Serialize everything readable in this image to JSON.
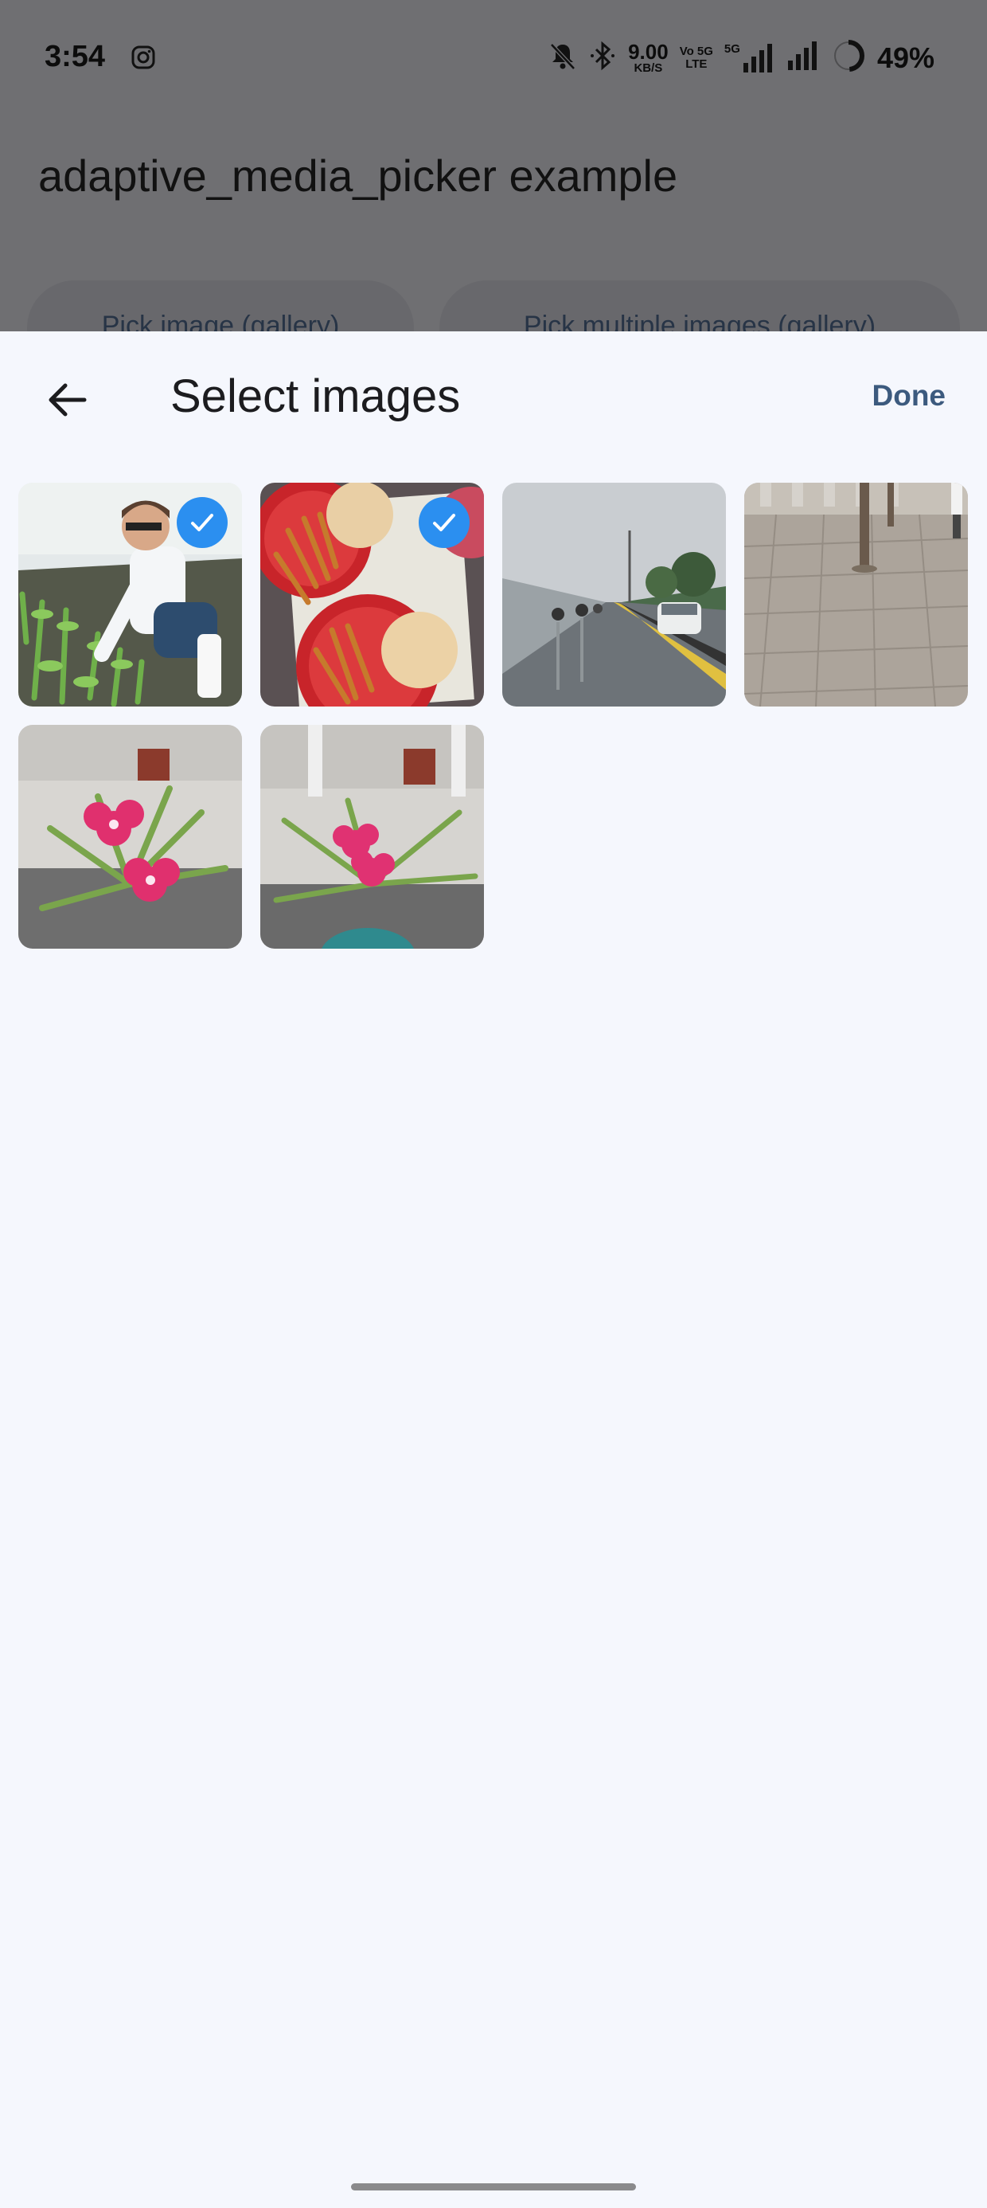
{
  "status_bar": {
    "time": "3:54",
    "net_speed_value": "9.00",
    "net_speed_unit": "KB/S",
    "volte_line1": "Vo 5G",
    "volte_line2": "LTE",
    "network_type": "5G",
    "battery_percent": "49%"
  },
  "app": {
    "title": "adaptive_media_picker example",
    "buttons": [
      "Pick image (gallery)",
      "Pick multiple images (gallery)"
    ]
  },
  "picker": {
    "title": "Select images",
    "done_label": "Done",
    "accent_color": "#2b8ff0",
    "images": [
      {
        "subject": "researcher-in-greenhouse",
        "selected": true
      },
      {
        "subject": "food-plates",
        "selected": true
      },
      {
        "subject": "rainy-road",
        "selected": false
      },
      {
        "subject": "paved-sidewalk-trees",
        "selected": false
      },
      {
        "subject": "pink-flowers",
        "selected": false
      },
      {
        "subject": "pink-flowers-pot",
        "selected": false
      }
    ]
  }
}
